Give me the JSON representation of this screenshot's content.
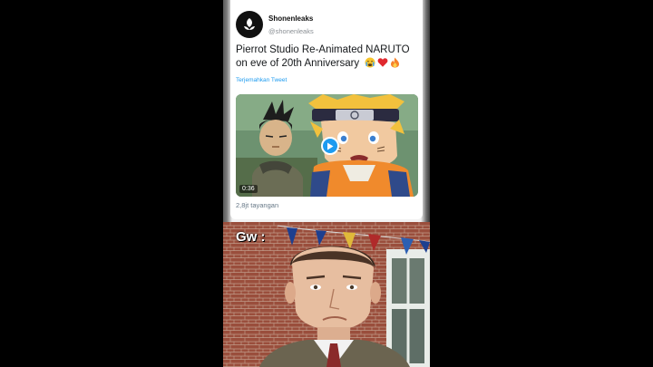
{
  "tweet": {
    "display_name": "Shonenleaks",
    "handle": "@shonenleaks",
    "text": "Pierrot Studio Re-Animated NARUTO on eve of 20th Anniversary",
    "emojis": [
      "crying-face-icon",
      "red-heart-icon",
      "fire-icon"
    ],
    "translate_link": "Terjemahkan Tweet",
    "video": {
      "duration": "0:36",
      "play_icon": "play-icon"
    },
    "views": "2,8jt tayangan"
  },
  "meme": {
    "caption": "Gw :"
  },
  "colors": {
    "link_blue": "#1d9bf0",
    "text_dark": "#14171a",
    "text_muted": "#657786",
    "page_bg": "#000000"
  }
}
